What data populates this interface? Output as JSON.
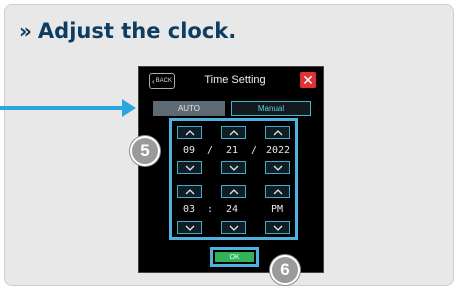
{
  "heading": {
    "chevron": "»",
    "text": "Adjust the clock."
  },
  "screen": {
    "back_label": "BACK",
    "title": "Time Setting",
    "close_icon": "✕",
    "tabs": {
      "auto": "AUTO",
      "manual": "Manual"
    },
    "date": {
      "month": "09",
      "sep1": "/",
      "day": "21",
      "sep2": "/",
      "year": "2022"
    },
    "time": {
      "hour": "03",
      "sep": ":",
      "minute": "24",
      "ampm": "PM"
    },
    "ok_label": "OK"
  },
  "callouts": {
    "picker": "5",
    "ok": "6"
  },
  "colors": {
    "highlight": "#4db3de",
    "arrow": "#2aa5de",
    "ok": "#2fb35a",
    "close": "#e03434",
    "heading": "#0d3d63"
  }
}
